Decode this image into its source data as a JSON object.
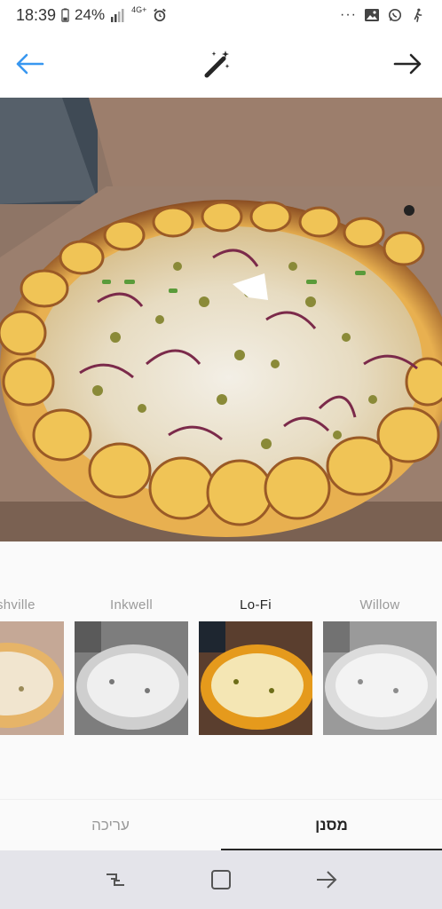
{
  "status": {
    "time": "18:39",
    "battery": "24%",
    "network": "4G+",
    "overflow": "···"
  },
  "topbar": {
    "back_icon": "arrow-left-icon",
    "edit_icon": "magic-wand-icon",
    "next_icon": "arrow-right-icon",
    "accent_color": "#3897f0"
  },
  "filters": [
    {
      "name": "Nashville",
      "style": "warm"
    },
    {
      "name": "Inkwell",
      "style": "mono"
    },
    {
      "name": "Lo-Fi",
      "style": "saturated",
      "selected": true
    },
    {
      "name": "Willow",
      "style": "mono-light"
    }
  ],
  "tabs": {
    "edit": "עריכה",
    "filter": "מסנן"
  },
  "nav": {
    "recents_icon": "recents-icon",
    "home_icon": "home-icon",
    "back_icon": "back-icon"
  }
}
